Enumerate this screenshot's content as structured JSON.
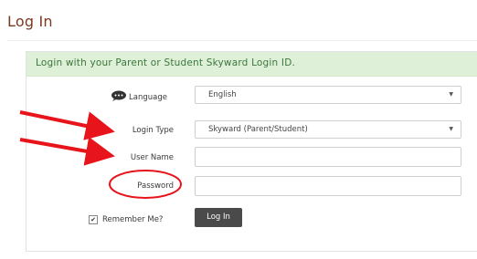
{
  "page": {
    "title": "Log In"
  },
  "panel": {
    "header": "Login with your Parent or Student Skyward Login ID."
  },
  "form": {
    "language": {
      "label": "Language",
      "value": "English",
      "icon": "speech-bubble-icon"
    },
    "login_type": {
      "label": "Login Type",
      "value": "Skyward (Parent/Student)"
    },
    "username": {
      "label": "User Name",
      "value": ""
    },
    "password": {
      "label": "Password",
      "value": ""
    },
    "remember": {
      "label": "Remember Me?",
      "checked": true
    },
    "submit_label": "Log In"
  },
  "annotations": {
    "arrow_color": "#e8141c",
    "circle_color": "#e8141c"
  },
  "colors": {
    "title": "#7a3a22",
    "header_bg": "#dff0d8",
    "header_text": "#3c763d",
    "button_bg": "#4a4a4a"
  }
}
